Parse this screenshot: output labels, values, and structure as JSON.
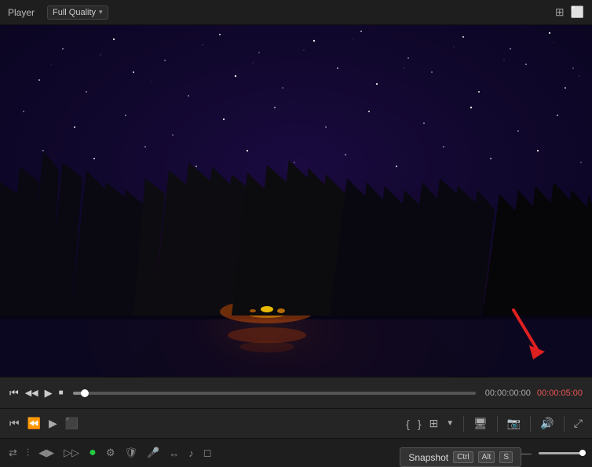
{
  "titlebar": {
    "app_label": "Player",
    "quality_label": "Full Quality",
    "chevron": "▾",
    "icon_grid": "⊞",
    "icon_image": "🖼"
  },
  "playback": {
    "time_current": "00:00:00:00",
    "time_end": "00:00:05:00",
    "progress_pct": 3
  },
  "controls": {
    "rewind": "⏮",
    "play_back": "⏪",
    "play_fwd": "▶",
    "stop": "■",
    "bracket_open": "{",
    "bracket_close": "}",
    "clip": "📋",
    "screen": "🖥",
    "camera": "📷",
    "volume": "🔊",
    "expand": "⤢"
  },
  "bottom": {
    "icons": [
      "⇄",
      "|||",
      "◀▶",
      "▷▷",
      "◯",
      "⚙",
      "🛡",
      "🎤",
      "↔",
      "♪",
      "◻",
      "—",
      "⊖"
    ],
    "smiley": "●",
    "snapshot_label": "Snapshot",
    "kbd_ctrl": "Ctrl",
    "kbd_alt": "Alt",
    "kbd_s": "S",
    "volume_max": true
  },
  "arrow": {
    "color": "#e02020"
  }
}
